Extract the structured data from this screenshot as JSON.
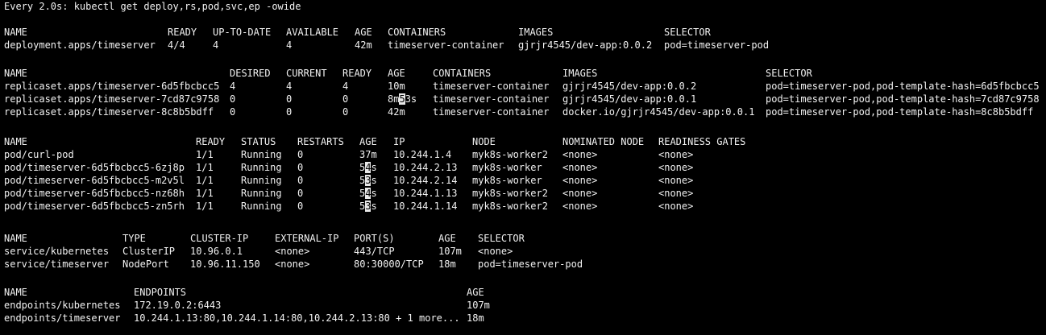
{
  "terminal": {
    "header": "Every 2.0s: kubectl get deploy,rs,pod,svc,ep -owide",
    "colors": {
      "background": "#000000",
      "text": "#f2f2f2",
      "cursor_block": "#e8e8e8"
    },
    "deployments": {
      "headers": [
        "NAME",
        "READY",
        "UP-TO-DATE",
        "AVAILABLE",
        "AGE",
        "CONTAINERS",
        "IMAGES",
        "SELECTOR"
      ],
      "rows": [
        [
          "deployment.apps/timeserver",
          "4/4",
          "4",
          "4",
          "42m",
          "timeserver-container",
          "gjrjr4545/dev-app:0.0.2",
          "pod=timeserver-pod"
        ]
      ]
    },
    "replicasets": {
      "headers": [
        "NAME",
        "DESIRED",
        "CURRENT",
        "READY",
        "AGE",
        "CONTAINERS",
        "IMAGES",
        "SELECTOR"
      ],
      "rows": [
        [
          "replicaset.apps/timeserver-6d5fbcbcc5",
          "4",
          "4",
          "4",
          "10m",
          "timeserver-container",
          "gjrjr4545/dev-app:0.0.2",
          "pod=timeserver-pod,pod-template-hash=6d5fbcbcc5"
        ],
        [
          "replicaset.apps/timeserver-7cd87c9758",
          "0",
          "0",
          "0",
          "8m53s",
          "timeserver-container",
          "gjrjr4545/dev-app:0.0.1",
          "pod=timeserver-pod,pod-template-hash=7cd87c9758"
        ],
        [
          "replicaset.apps/timeserver-8c8b5bdff",
          "0",
          "0",
          "0",
          "42m",
          "timeserver-container",
          "docker.io/gjrjr4545/dev-app:0.0.1",
          "pod=timeserver-pod,pod-template-hash=8c8b5bdff"
        ]
      ]
    },
    "pods": {
      "headers": [
        "NAME",
        "READY",
        "STATUS",
        "RESTARTS",
        "AGE",
        "IP",
        "NODE",
        "NOMINATED NODE",
        "READINESS GATES"
      ],
      "rows": [
        [
          "pod/curl-pod",
          "1/1",
          "Running",
          "0",
          "37m",
          "10.244.1.4",
          "myk8s-worker2",
          "<none>",
          "<none>"
        ],
        [
          "pod/timeserver-6d5fbcbcc5-6zj8p",
          "1/1",
          "Running",
          "0",
          "54s",
          "10.244.2.13",
          "myk8s-worker",
          "<none>",
          "<none>"
        ],
        [
          "pod/timeserver-6d5fbcbcc5-m2v5l",
          "1/1",
          "Running",
          "0",
          "53s",
          "10.244.2.14",
          "myk8s-worker",
          "<none>",
          "<none>"
        ],
        [
          "pod/timeserver-6d5fbcbcc5-nz68h",
          "1/1",
          "Running",
          "0",
          "54s",
          "10.244.1.13",
          "myk8s-worker2",
          "<none>",
          "<none>"
        ],
        [
          "pod/timeserver-6d5fbcbcc5-zn5rh",
          "1/1",
          "Running",
          "0",
          "53s",
          "10.244.1.14",
          "myk8s-worker2",
          "<none>",
          "<none>"
        ]
      ]
    },
    "services": {
      "headers": [
        "NAME",
        "TYPE",
        "CLUSTER-IP",
        "EXTERNAL-IP",
        "PORT(S)",
        "AGE",
        "SELECTOR"
      ],
      "rows": [
        [
          "service/kubernetes",
          "ClusterIP",
          "10.96.0.1",
          "<none>",
          "443/TCP",
          "107m",
          "<none>"
        ],
        [
          "service/timeserver",
          "NodePort",
          "10.96.11.150",
          "<none>",
          "80:30000/TCP",
          "18m",
          "pod=timeserver-pod"
        ]
      ]
    },
    "endpoints": {
      "headers": [
        "NAME",
        "ENDPOINTS",
        "AGE"
      ],
      "rows": [
        [
          "endpoints/kubernetes",
          "172.19.0.2:6443",
          "107m"
        ],
        [
          "endpoints/timeserver",
          "10.244.1.13:80,10.244.1.14:80,10.244.2.13:80 + 1 more...",
          "18m"
        ]
      ]
    }
  }
}
